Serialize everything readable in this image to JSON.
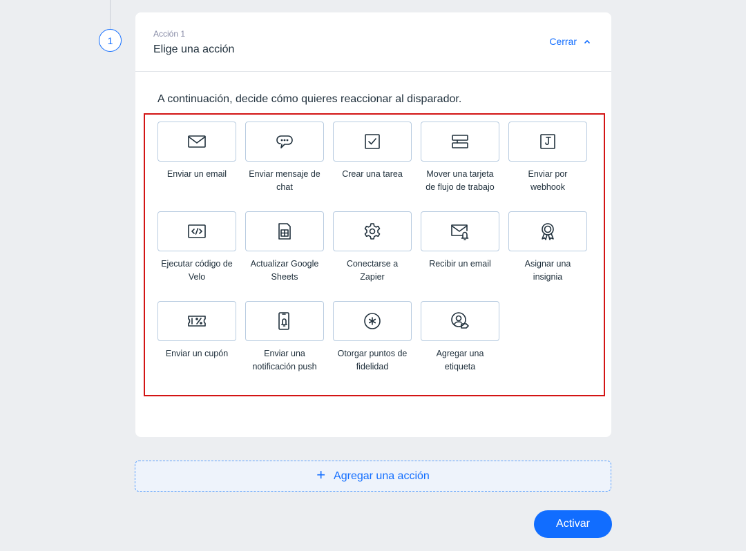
{
  "step": {
    "number": "1",
    "label": "Acción 1",
    "title": "Elige una acción",
    "close_label": "Cerrar"
  },
  "intro_text": "A continuación, decide cómo quieres reaccionar al disparador.",
  "actions": [
    {
      "label": "Enviar un email",
      "icon": "email-icon"
    },
    {
      "label": "Enviar mensaje de chat",
      "icon": "chat-bubble-icon"
    },
    {
      "label": "Crear una tarea",
      "icon": "checkbox-icon"
    },
    {
      "label": "Mover una tarjeta de flujo de trabajo",
      "icon": "workflow-card-icon"
    },
    {
      "label": "Enviar por webhook",
      "icon": "webhook-icon"
    },
    {
      "label": "Ejecutar código de Velo",
      "icon": "code-icon"
    },
    {
      "label": "Actualizar Google Sheets",
      "icon": "spreadsheet-icon"
    },
    {
      "label": "Conectarse a Zapier",
      "icon": "gear-icon"
    },
    {
      "label": "Recibir un email",
      "icon": "email-bell-icon"
    },
    {
      "label": "Asignar una insignia",
      "icon": "badge-icon"
    },
    {
      "label": "Enviar un cupón",
      "icon": "coupon-icon"
    },
    {
      "label": "Enviar una notificación push",
      "icon": "phone-bell-icon"
    },
    {
      "label": "Otorgar puntos de fidelidad",
      "icon": "loyalty-points-icon"
    },
    {
      "label": "Agregar una etiqueta",
      "icon": "user-tag-icon"
    }
  ],
  "add_action_label": "Agregar una acción",
  "activate_label": "Activar",
  "colors": {
    "accent": "#116dff",
    "highlight_frame": "#d31414",
    "background": "#eceef1"
  }
}
